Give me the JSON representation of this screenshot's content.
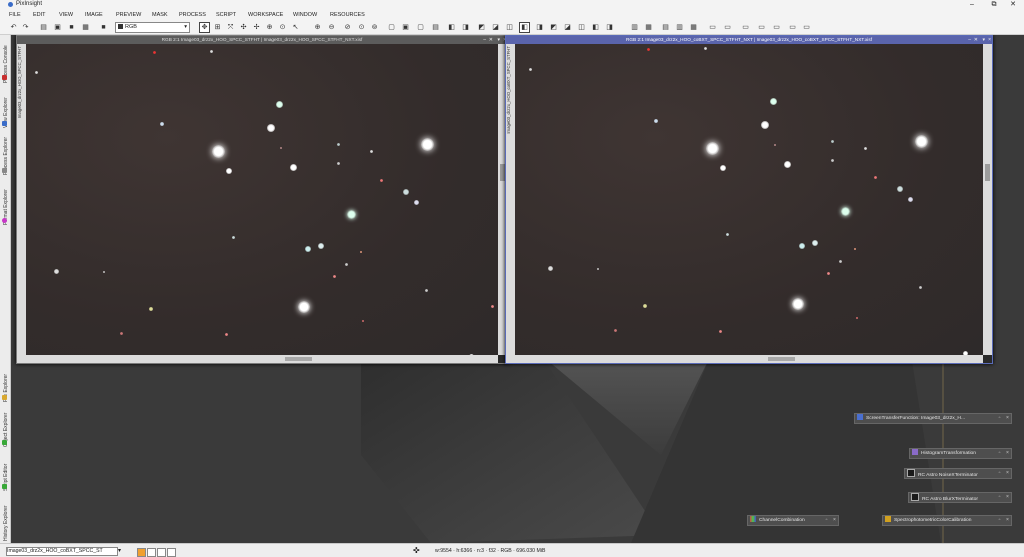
{
  "app": {
    "title": "PixInsight"
  },
  "menu": [
    "FILE",
    "EDIT",
    "VIEW",
    "IMAGE",
    "PREVIEW",
    "MASK",
    "PROCESS",
    "SCRIPT",
    "WORKSPACE",
    "WINDOW",
    "RESOURCES"
  ],
  "toolbar": {
    "color_mode": "RGB"
  },
  "left_dock": [
    "Process Console",
    "View Explorer",
    "Process Explorer",
    "Format Explorer",
    "File Explorer",
    "Object Explorer",
    "Script Editor",
    "History Explorer"
  ],
  "windows": [
    {
      "title": "RGB 2:1 Image03_drz2x_HOO_SPCC_STFHT | Image03_drz2x_HOO_SPCC_STFHT_NXT.xisf",
      "ruler": "Image03_drz2x_HOO_SPCC_STFHT",
      "active": false
    },
    {
      "title": "RGB 2:1 Image03_drz2x_HOO_coBXT_SPCC_STFHT_NXT | Image03_drz2x_HOO_coBXT_SPCC_STFHT_NXT.xisf",
      "ruler": "Image03_drz2x_HOO_coBXT_SPCC_STFHT",
      "active": true
    }
  ],
  "process_icons": [
    {
      "label": "ScreenTransferFunction: Image03_drz2x_H...",
      "icon_color": "#4a6fd0"
    },
    {
      "label": "HistogramTransformation",
      "icon_color": "#8a6bc8"
    },
    {
      "label": "RC Astro NoiseXTerminator",
      "icon_color": "#1a1a1a"
    },
    {
      "label": "RC Astro BlurXTerminator",
      "icon_color": "#1a1a1a"
    },
    {
      "label": "ChannelCombination",
      "icon_color": "#c84a4a"
    },
    {
      "label": "SpectrophotometricColorCalibration",
      "icon_color": "#d0a020"
    }
  ],
  "status": {
    "view": "Image03_drz2x_HOO_coBXT_SPCC_ST",
    "readout": "w:9554 · h:6366 · n:3 · f32 · RGB · 696.030 MiB"
  },
  "colors": {
    "accent": "#5a64ac",
    "workspace": "#3a3a3a"
  }
}
